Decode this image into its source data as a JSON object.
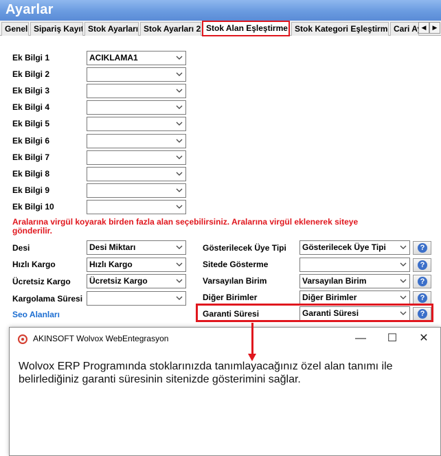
{
  "window": {
    "title": "Ayarlar"
  },
  "tabs": [
    {
      "label": "Genel"
    },
    {
      "label": "Sipariş Kayıt"
    },
    {
      "label": "Stok Ayarları"
    },
    {
      "label": "Stok Ayarları 2"
    },
    {
      "label": "Stok Alan Eşleştirme"
    },
    {
      "label": "Stok Kategori Eşleştirme"
    },
    {
      "label": "Cari Ay"
    }
  ],
  "tab_scroll": {
    "left": "◀",
    "right": "▶"
  },
  "ek_bilgi": [
    {
      "label": "Ek Bilgi 1",
      "value": "ACIKLAMA1"
    },
    {
      "label": "Ek Bilgi 2",
      "value": ""
    },
    {
      "label": "Ek Bilgi 3",
      "value": ""
    },
    {
      "label": "Ek Bilgi 4",
      "value": ""
    },
    {
      "label": "Ek Bilgi 5",
      "value": ""
    },
    {
      "label": "Ek Bilgi 6",
      "value": ""
    },
    {
      "label": "Ek Bilgi 7",
      "value": ""
    },
    {
      "label": "Ek Bilgi 8",
      "value": ""
    },
    {
      "label": "Ek Bilgi 9",
      "value": ""
    },
    {
      "label": "Ek Bilgi 10",
      "value": ""
    }
  ],
  "warning": "Aralarına virgül koyarak birden fazla alan seçebilirsiniz. Aralarına virgül  eklenerek siteye gönderilir.",
  "left_fields": [
    {
      "label": "Desi",
      "value": "Desi Miktarı"
    },
    {
      "label": "Hızlı Kargo",
      "value": "Hızlı Kargo"
    },
    {
      "label": "Ücretsiz Kargo",
      "value": "Ücretsiz Kargo"
    },
    {
      "label": "Kargolama Süresi",
      "value": ""
    }
  ],
  "seo_link": "Seo Alanları",
  "right_fields": [
    {
      "label": "Gösterilecek Üye Tipi",
      "value": "Gösterilecek Üye Tipi"
    },
    {
      "label": "Sitede Gösterme",
      "value": ""
    },
    {
      "label": "Varsayılan Birim",
      "value": "Varsayılan  Birim"
    },
    {
      "label": "Diğer Birimler",
      "value": "Diğer Birimler"
    },
    {
      "label": "Garanti Süresi",
      "value": "Garanti Süresi"
    }
  ],
  "help_glyph": "?",
  "dialog": {
    "title": "AKINSOFT Wolvox WebEntegrasyon",
    "minimize": "—",
    "maximize": "☐",
    "close": "✕",
    "message": "Wolvox ERP Programında stoklarınızda tanımlayacağınız özel alan tanımı ile belirlediğiniz garanti süresinin sitenizde gösterimini sağlar."
  },
  "colors": {
    "highlight": "#e0171e",
    "link": "#1b6dd1",
    "title_bar": "#6a9be0"
  }
}
